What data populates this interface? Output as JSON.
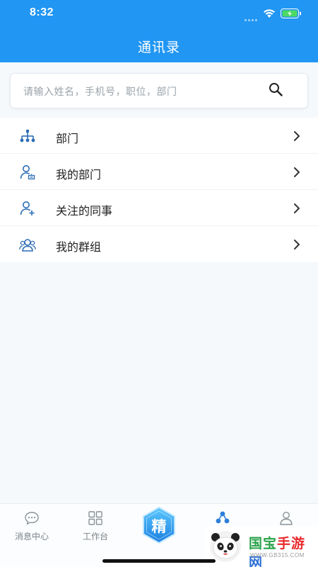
{
  "status_bar": {
    "time": "8:32"
  },
  "header": {
    "title": "通讯录"
  },
  "search": {
    "placeholder": "请输入姓名，手机号，职位，部门"
  },
  "menu": {
    "items": [
      {
        "label": "部门",
        "icon": "org-chart-icon"
      },
      {
        "label": "我的部门",
        "icon": "user-department-icon"
      },
      {
        "label": "关注的同事",
        "icon": "add-user-icon"
      },
      {
        "label": "我的群组",
        "icon": "group-icon"
      }
    ]
  },
  "tabbar": {
    "tabs": [
      {
        "label": "消息中心",
        "icon": "chat-bubble-icon"
      },
      {
        "label": "工作台",
        "icon": "grid-icon"
      },
      {
        "label": "",
        "icon": "center-badge-icon"
      },
      {
        "label": "",
        "icon": "contacts-icon"
      },
      {
        "label": "",
        "icon": "profile-icon"
      }
    ],
    "center_badge_text": "精"
  },
  "watermark": {
    "text_part1": "国宝",
    "text_part2": "手游",
    "text_part3": "网",
    "url": "WWW.GB315.COM"
  },
  "colors": {
    "primary": "#2196f3",
    "icon_blue": "#2c6db5",
    "background": "#f5f9fc"
  }
}
